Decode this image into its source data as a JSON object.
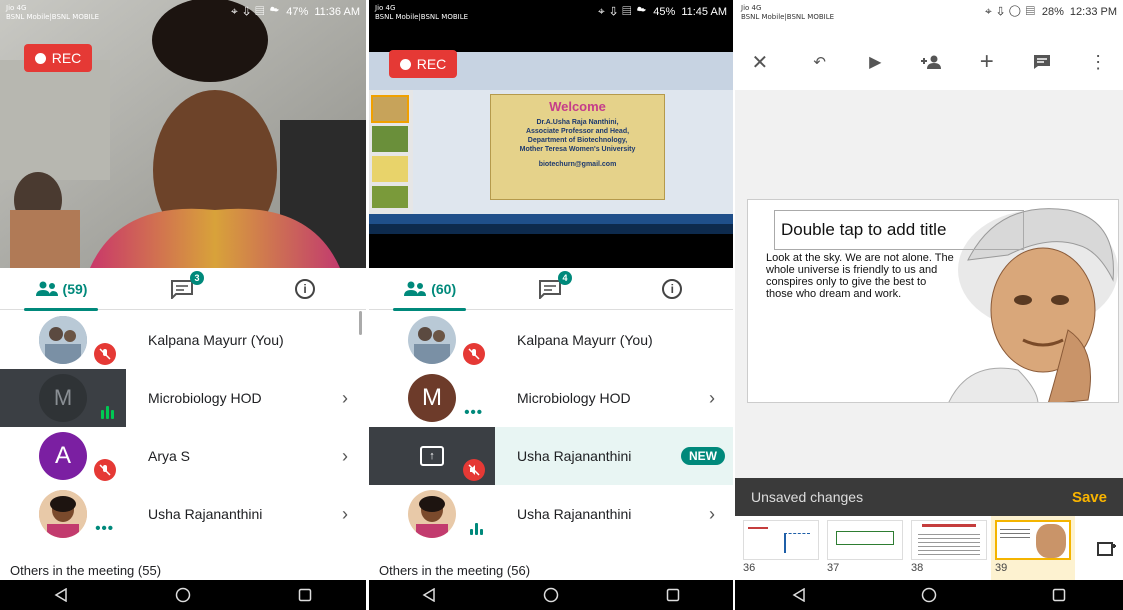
{
  "phone1": {
    "status": {
      "carrier": "Jio 4G\nBSNL Mobile|BSNL MOBILE",
      "battery": "47%",
      "time": "11:36 AM"
    },
    "rec_label": "REC",
    "tabs": {
      "people_count": "(59)",
      "chat_badge": "3"
    },
    "participants": [
      {
        "name": "Kalpana Mayurr (You)",
        "avatar_letter": "",
        "state": "muted"
      },
      {
        "name": "Microbiology HOD",
        "avatar_letter": "M",
        "state": "speaking"
      },
      {
        "name": "Arya S",
        "avatar_letter": "A",
        "state": "muted"
      },
      {
        "name": "Usha Rajananthini",
        "avatar_letter": "",
        "state": "dots"
      }
    ],
    "others": "Others in the meeting (55)"
  },
  "phone2": {
    "status": {
      "carrier": "Jio 4G\nBSNL Mobile|BSNL MOBILE",
      "battery": "45%",
      "time": "11:45 AM"
    },
    "rec_label": "REC",
    "presentation": {
      "welcome": "Welcome",
      "lines": [
        "Dr.A.Usha Raja Nanthini,",
        "Associate Professor and Head,",
        "Department of Biotechnology,",
        "Mother Teresa Women's University",
        "",
        "biotechurn@gmail.com"
      ]
    },
    "tabs": {
      "people_count": "(60)",
      "chat_badge": "4"
    },
    "participants": [
      {
        "name": "Kalpana Mayurr (You)",
        "avatar_letter": "",
        "state": "muted"
      },
      {
        "name": "Microbiology HOD",
        "avatar_letter": "M",
        "state": "dots"
      },
      {
        "name": "Usha Rajananthini",
        "avatar_letter": "",
        "state": "presenting",
        "badge": "NEW"
      },
      {
        "name": "Usha Rajananthini",
        "avatar_letter": "",
        "state": "speaking"
      }
    ],
    "others": "Others in the meeting (56)"
  },
  "phone3": {
    "status": {
      "carrier": "Jio 4G\nBSNL Mobile|BSNL MOBILE",
      "battery": "28%",
      "time": "12:33 PM"
    },
    "slide": {
      "title_placeholder": "Double tap to add title",
      "quote": "Look at the sky. We are not alone. The whole universe is friendly to us and conspires only to give the best to those who dream and work."
    },
    "unsaved": "Unsaved changes",
    "save": "Save",
    "thumbnails": [
      "36",
      "37",
      "38",
      "39"
    ],
    "selected_thumbnail": "39"
  },
  "icons": [
    "people-icon",
    "chat-icon",
    "info-icon",
    "mic-off-icon",
    "chevron-right-icon",
    "back-nav-icon",
    "home-nav-icon",
    "recents-nav-icon",
    "close-icon",
    "undo-icon",
    "play-icon",
    "add-person-icon",
    "plus-icon",
    "comment-icon",
    "more-icon",
    "add-slide-icon",
    "present-icon"
  ],
  "colors": {
    "rec": "#e53935",
    "teal": "#00897b",
    "save": "#f9b400"
  }
}
